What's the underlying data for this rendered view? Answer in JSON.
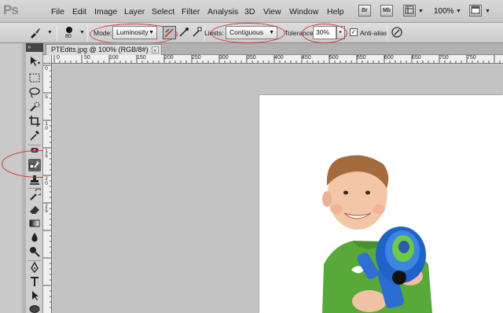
{
  "app": {
    "logo": "Ps"
  },
  "menu": [
    "File",
    "Edit",
    "Image",
    "Layer",
    "Select",
    "Filter",
    "Analysis",
    "3D",
    "View",
    "Window",
    "Help"
  ],
  "menubar_icons": [
    "Br",
    "Mb"
  ],
  "zoom": "100%",
  "options": {
    "brush_size": "80",
    "mode_label": "Mode:",
    "mode_value": "Luminosity",
    "limits_label": "Limits:",
    "limits_value": "Contiguous",
    "tolerance_label": "Tolerance:",
    "tolerance_value": "30%",
    "antialias_label": "Anti-alias",
    "antialias_checked": "✓"
  },
  "document_tab": {
    "title": "PTEdits.jpg @ 100% (RGB/8#)",
    "close": "×"
  },
  "tools_header": "»",
  "ruler_h_labels": [
    "0",
    "50",
    "100",
    "150",
    "200",
    "250",
    "300",
    "350",
    "400",
    "450",
    "500",
    "550",
    "600",
    "650",
    "700",
    "750"
  ],
  "ruler_v_labels": [
    "0",
    "5",
    "1 0",
    "1 5",
    "2 0",
    "2 5"
  ],
  "annotation_color": "#d43434"
}
